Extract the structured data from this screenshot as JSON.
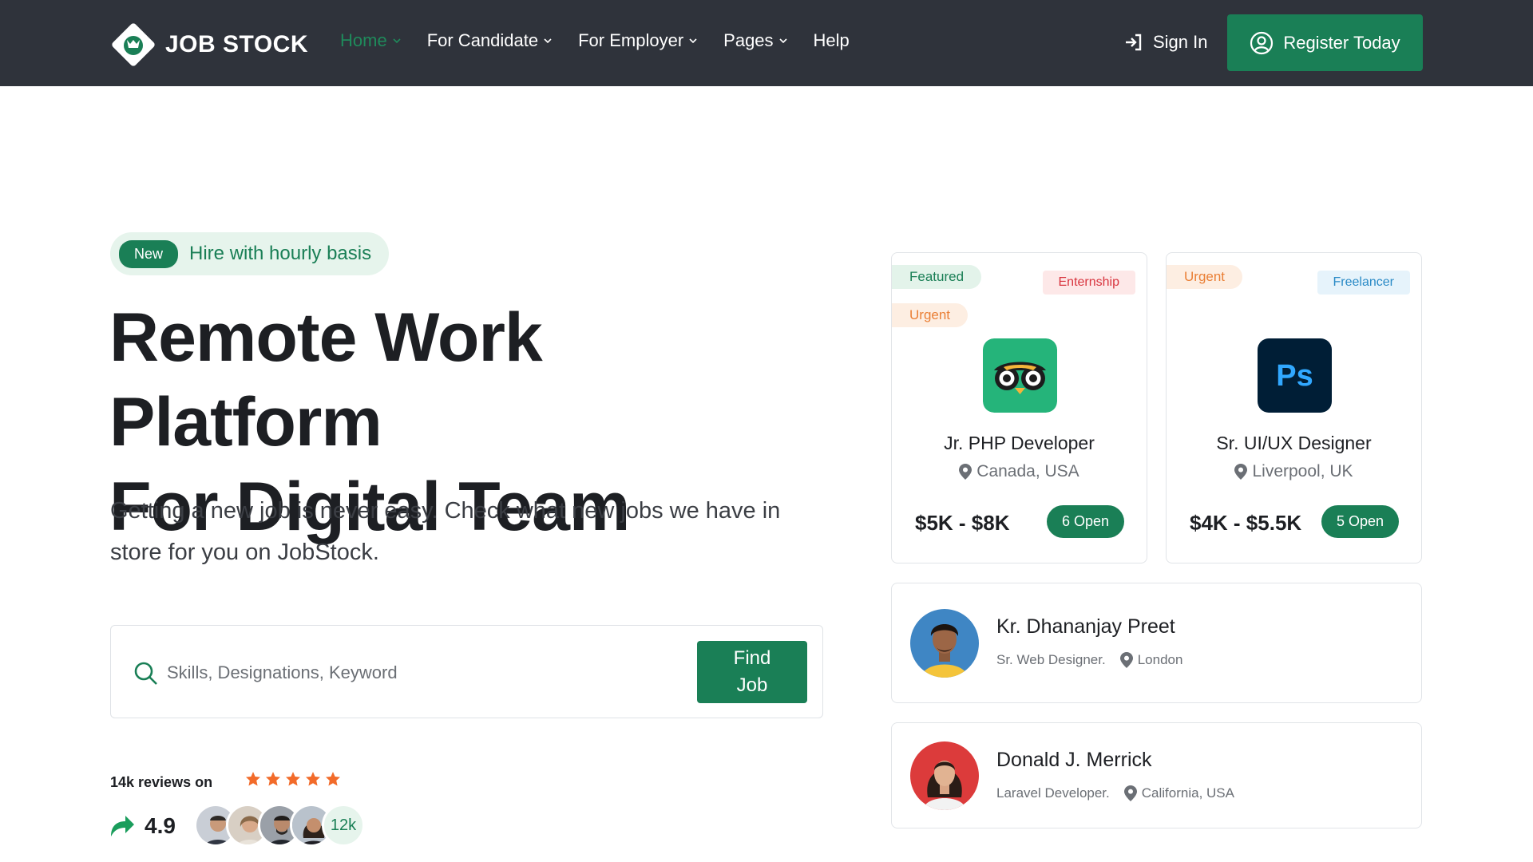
{
  "brand": {
    "name": "JOB STOCK"
  },
  "nav": {
    "items": [
      {
        "label": "Home",
        "active": true
      },
      {
        "label": "For Candidate",
        "active": false
      },
      {
        "label": "For Employer",
        "active": false
      },
      {
        "label": "Pages",
        "active": false
      },
      {
        "label": "Help",
        "active": false
      }
    ],
    "signin_label": "Sign In",
    "register_label": "Register Today"
  },
  "hero": {
    "badge_new": "New",
    "badge_text": "Hire with hourly basis",
    "title_line1": "Remote Work Platform",
    "title_line2": "For Digital Team",
    "subtitle": "Getting a new job is never easy. Check what new jobs we have in store for you on JobStock.",
    "search_placeholder": "Skills, Designations, Keyword",
    "find_button": "Find\nJob",
    "reviews_label": "14k reviews on",
    "stars": 5,
    "rating": "4.9",
    "reviewer_count": "12k"
  },
  "jobs": [
    {
      "tags": [
        "Featured",
        "Urgent"
      ],
      "type_tag": "Enternship",
      "logo_icon": "tripadvisor-owl-icon",
      "title": "Jr. PHP Developer",
      "location": "Canada, USA",
      "salary": "$5K - $8K",
      "open": "6 Open"
    },
    {
      "tags": [
        "Urgent"
      ],
      "type_tag": "Freelancer",
      "logo_icon": "photoshop-icon",
      "logo_text": "Ps",
      "title": "Sr. UI/UX Designer",
      "location": "Liverpool, UK",
      "salary": "$4K - $5.5K",
      "open": "5 Open"
    }
  ],
  "candidates": [
    {
      "name": "Kr. Dhananjay Preet",
      "role": "Sr. Web Designer.",
      "location": "London"
    },
    {
      "name": "Donald J. Merrick",
      "role": "Laravel Developer.",
      "location": "California, USA"
    }
  ],
  "colors": {
    "primary": "#1a7f56",
    "header_bg": "#2f333b",
    "urgent": "#ea7f35",
    "star": "#f26b2a"
  }
}
